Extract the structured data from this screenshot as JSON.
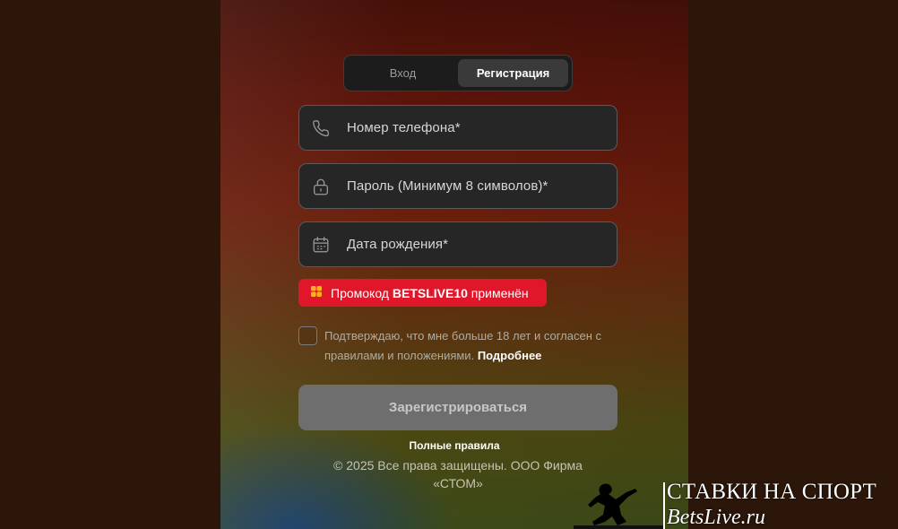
{
  "tabs": [
    {
      "label": "Вход",
      "active": false
    },
    {
      "label": "Регистрация",
      "active": true
    }
  ],
  "fields": {
    "phone": {
      "placeholder": "Номер телефона*",
      "icon": "phone-icon"
    },
    "password": {
      "placeholder": "Пароль (Минимум 8 символов)*",
      "icon": "lock-icon"
    },
    "birthdate": {
      "placeholder": "Дата рождения*",
      "icon": "calendar-icon"
    }
  },
  "promo": {
    "prefix": "Промокод",
    "code": "BETSLIVE10",
    "suffix": "применён",
    "icon": "gift-icon",
    "color": "#e0172a"
  },
  "agreement": {
    "text": "Подтверждаю, что мне больше 18 лет и согласен с правилами и положениями.",
    "link": "Подробнее",
    "checked": false
  },
  "submit": {
    "label": "Зарегистрироваться"
  },
  "footer": {
    "rules": "Полные правила",
    "copyright": "© 2025 Все права защищены. ООО Фирма «СТОМ»"
  },
  "watermark": {
    "line1": "СТАВКИ НА СПОРТ",
    "line2": "BetsLive.ru"
  }
}
